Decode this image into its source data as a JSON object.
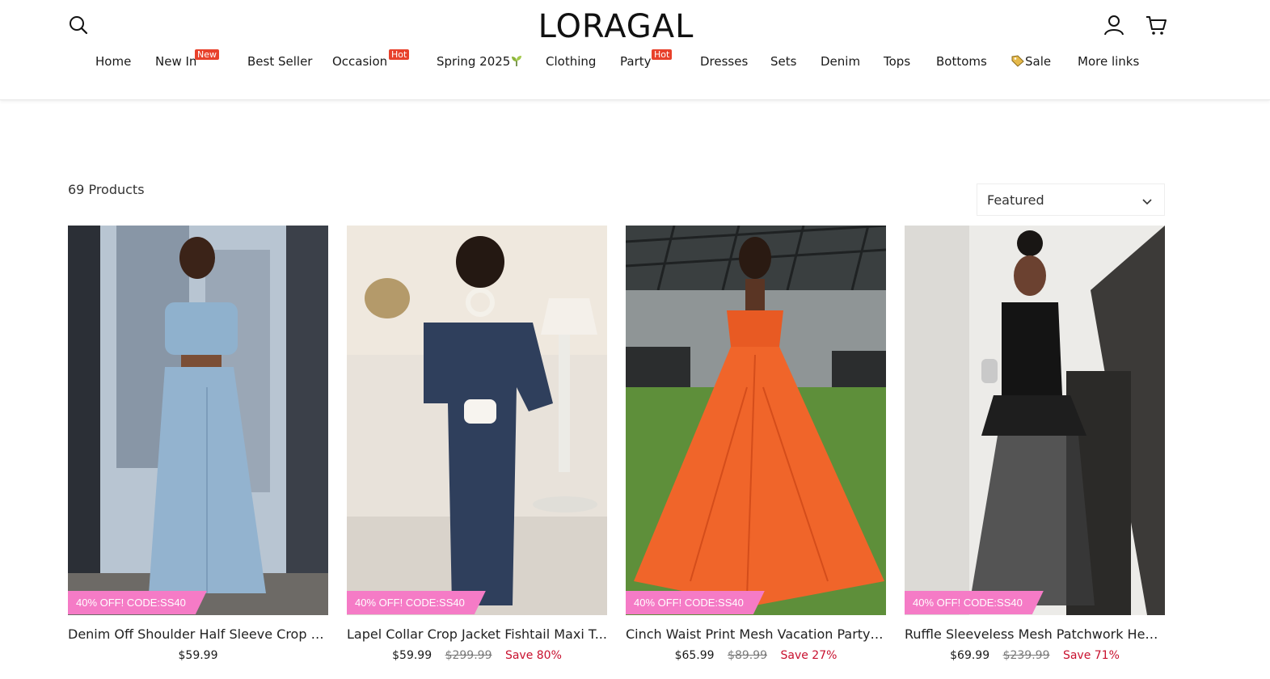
{
  "header": {
    "logo": "LORAGAL",
    "icons": {
      "search": "search-icon",
      "account": "user-icon",
      "cart": "cart-icon"
    }
  },
  "nav": {
    "items": [
      {
        "label": "Home"
      },
      {
        "label": "New In",
        "badge": "New"
      },
      {
        "label": "Best Seller"
      },
      {
        "label": "Occasion",
        "badge": "Hot"
      },
      {
        "label": "Spring 2025",
        "emoji": "🌱"
      },
      {
        "label": "Clothing"
      },
      {
        "label": "Party",
        "badge": "Hot"
      },
      {
        "label": "Dresses"
      },
      {
        "label": "Sets"
      },
      {
        "label": "Denim"
      },
      {
        "label": "Tops"
      },
      {
        "label": "Bottoms"
      },
      {
        "label": "Sale",
        "emoji": "🏷️"
      },
      {
        "label": "More links"
      }
    ],
    "badge_color": "#e8412b"
  },
  "collection": {
    "count": "69 Products",
    "sort": {
      "selected": "Featured"
    }
  },
  "promo_color": "#f57bc6",
  "products": [
    {
      "title": "Denim Off Shoulder Half Sleeve Crop T...",
      "promo": "40% OFF! CODE:SS40",
      "price": "$59.99",
      "compare": "",
      "save": ""
    },
    {
      "title": "Lapel Collar Crop Jacket Fishtail Maxi T...",
      "promo": "40% OFF! CODE:SS40",
      "price": "$59.99",
      "compare": "$299.99",
      "save": "Save 80%"
    },
    {
      "title": "Cinch Waist Print Mesh Vacation Party ...",
      "promo": "40% OFF! CODE:SS40",
      "price": "$65.99",
      "compare": "$89.99",
      "save": "Save 27%"
    },
    {
      "title": "Ruffle Sleeveless Mesh Patchwork Hem ...",
      "promo": "40% OFF! CODE:SS40",
      "price": "$69.99",
      "compare": "$239.99",
      "save": "Save 71%"
    }
  ]
}
